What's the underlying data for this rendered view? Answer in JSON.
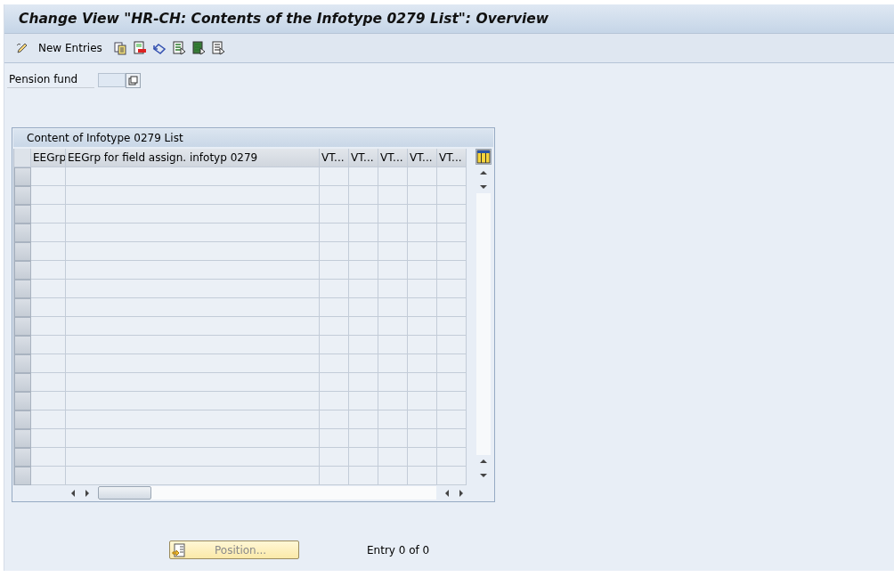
{
  "window": {
    "title": "Change View \"HR-CH: Contents of the Infotype 0279 List\": Overview"
  },
  "toolbar": {
    "new_entries": "New Entries"
  },
  "pension_fund": {
    "label": "Pension fund"
  },
  "table": {
    "title": "Content of Infotype 0279 List",
    "columns": [
      "EEGrp",
      "EEGrp for field assign. infotyp 0279",
      "VT...",
      "VT...",
      "VT...",
      "VT...",
      "VT..."
    ]
  },
  "position_button": {
    "label": "Position...",
    "disabled": true
  },
  "entry_count": "Entry 0 of 0"
}
